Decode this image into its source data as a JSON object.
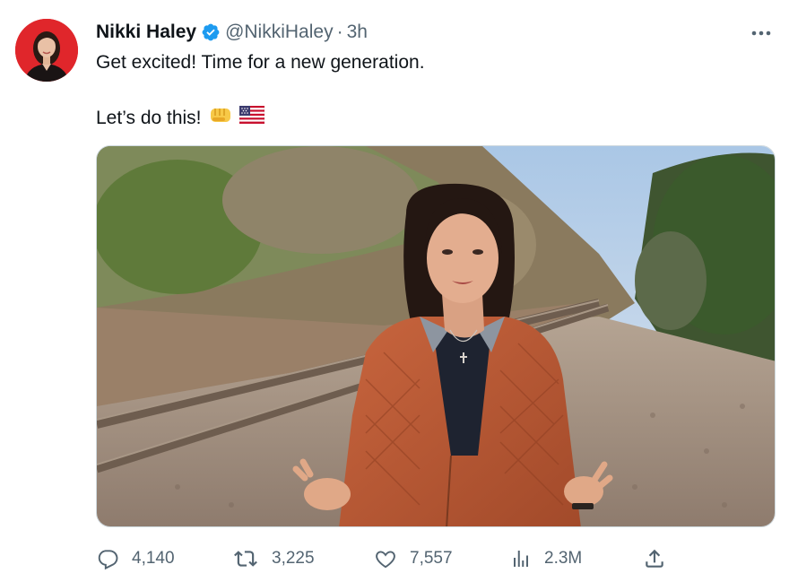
{
  "tweet": {
    "display_name": "Nikki Haley",
    "handle": "@NikkiHaley",
    "separator": "·",
    "time": "3h",
    "text_line1": "Get excited! Time for a new generation.",
    "text_line2": "Let’s do this!",
    "emojis": [
      "oncoming-fist-emoji",
      "us-flag-emoji"
    ],
    "verified_icon": "verified-badge-icon",
    "more_icon": "more-dots-icon"
  },
  "actions": {
    "reply_count": "4,140",
    "retweet_count": "3,225",
    "like_count": "7,557",
    "views_count": "2.3M"
  },
  "icons": [
    "reply-icon",
    "retweet-icon",
    "like-icon",
    "views-icon",
    "share-icon"
  ],
  "colors": {
    "verified": "#1d9bf0",
    "text": "#0f1419",
    "secondary": "#536471",
    "avatar_bg": "#e0262b"
  }
}
